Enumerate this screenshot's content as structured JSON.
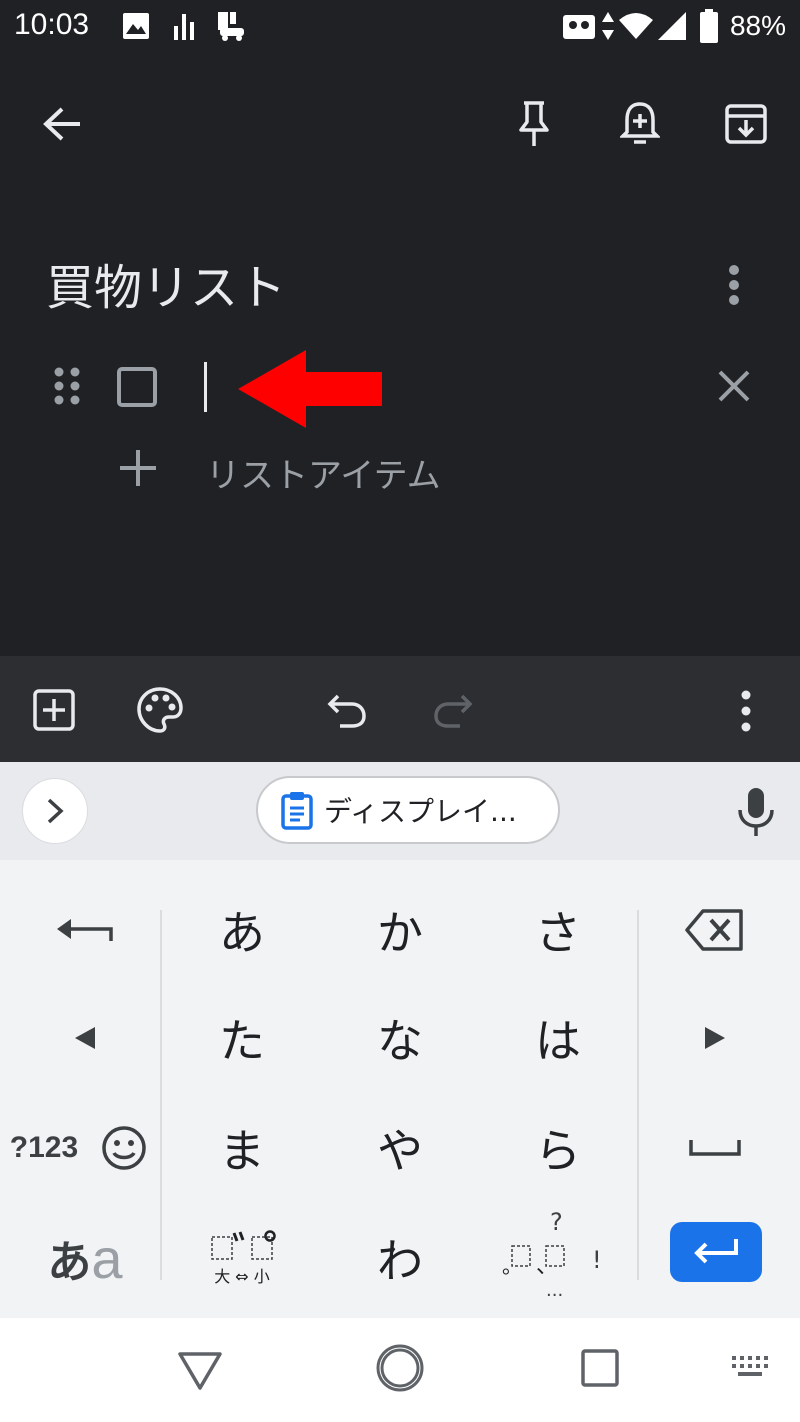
{
  "status_bar": {
    "time": "10:03",
    "battery": "88%"
  },
  "note": {
    "title": "買物リスト",
    "add_item_label": "リストアイテム"
  },
  "keyboard": {
    "suggestion": "ディスプレイ...",
    "row1": [
      "あ",
      "か",
      "さ"
    ],
    "row2": [
      "た",
      "な",
      "は"
    ],
    "row3": [
      "ま",
      "や",
      "ら"
    ],
    "row4_center": "わ",
    "num_key": "?123",
    "lang_key_a": "あ",
    "lang_key_b": "a",
    "dakuten_sub": "大 ⇔ 小",
    "punct_q": "?",
    "punct_ex": "!",
    "punct_dots": "...",
    "punct_comma": "、",
    "punct_period": "。"
  },
  "colors": {
    "accent_blue": "#1a73e8",
    "arrow_red": "#ff0000",
    "dark_bg": "#202124"
  }
}
